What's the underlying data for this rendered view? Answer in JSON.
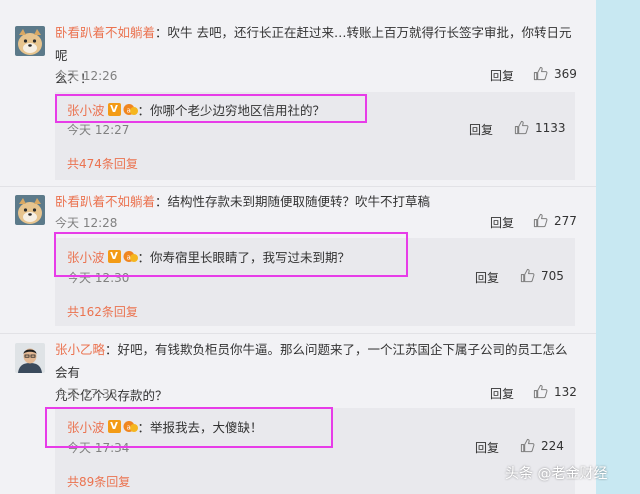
{
  "comments": [
    {
      "user": "卧看趴着不如躺着",
      "text_line1": "：吹牛   去吧，还行长正在赶过来…转账上百万就得行长签字审批，你转日元呢",
      "text_line2": "么？！",
      "time": "今天 12:26",
      "reply_label": "回复",
      "likes": "369",
      "sub": {
        "user": "张小波",
        "text": "：你哪个老少边穷地区信用社的？",
        "time": "今天 12:27",
        "reply_label": "回复",
        "likes": "1133"
      },
      "more": "共474条回复"
    },
    {
      "user": "卧看趴着不如躺着",
      "text_line1": "：结构性存款未到期随便取随便转？吹牛不打草稿",
      "time": "今天 12:28",
      "reply_label": "回复",
      "likes": "277",
      "sub": {
        "user": "张小波",
        "text": "：你寿宿里长眼睛了，我写过未到期？",
        "time": "今天 12:30",
        "reply_label": "回复",
        "likes": "705"
      },
      "more": "共162条回复"
    },
    {
      "user": "张小乙略",
      "text_line1": "：好吧，有钱欺负柜员你牛逼。那么问题来了，一个江苏国企下属子公司的员工怎么会有",
      "text_line2": "几个亿个人存款的？",
      "time": "今天 17:33",
      "reply_label": "回复",
      "likes": "132",
      "sub": {
        "user": "张小波",
        "text": "：举报我去，大傻缺！",
        "time": "今天 17:34",
        "reply_label": "回复",
        "likes": "224"
      },
      "more": "共89条回复"
    }
  ],
  "badge_v": "V",
  "watermark": "头条 @老金财经",
  "colors": {
    "username": "#eb7350",
    "highlight": "#e73ce8",
    "panel": "#c8e8f2"
  }
}
